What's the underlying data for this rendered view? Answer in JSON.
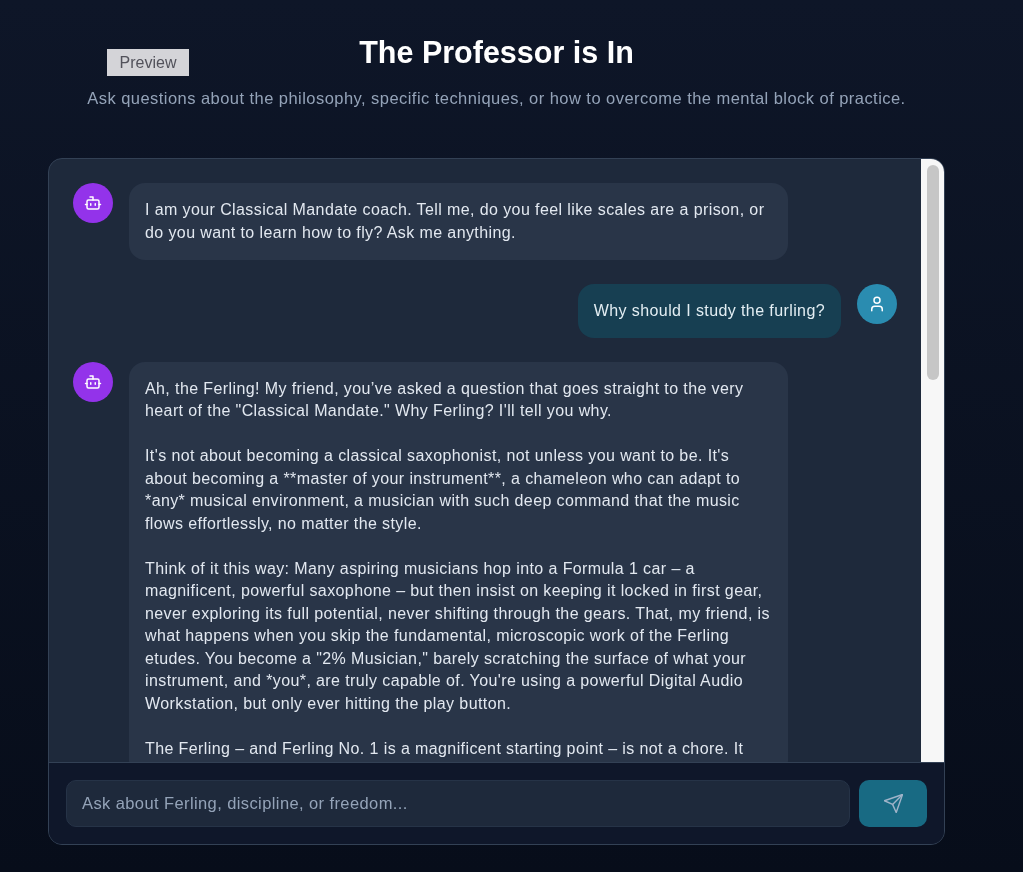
{
  "header": {
    "badge": "Preview",
    "title": "The Professor is In",
    "subtitle": "Ask questions about the philosophy, specific techniques, or how to overcome the mental block of practice."
  },
  "chat": {
    "messages": [
      {
        "kind": "bot",
        "paragraphs": [
          "I am your Classical Mandate coach. Tell me, do you feel like scales are a prison, or do you want to learn how to fly? Ask me anything."
        ]
      },
      {
        "kind": "user",
        "paragraphs": [
          "Why should I study the furling?"
        ]
      },
      {
        "kind": "bot",
        "paragraphs": [
          "Ah, the Ferling! My friend, you’ve asked a question that goes straight to the very heart of the \"Classical Mandate.\" Why Ferling? I'll tell you why.",
          "It's not about becoming a classical saxophonist, not unless you want to be. It's about becoming a **master of your instrument**, a chameleon who can adapt to *any* musical environment, a musician with such deep command that the music flows effortlessly, no matter the style.",
          "Think of it this way: Many aspiring musicians hop into a Formula 1 car – a magnificent, powerful saxophone – but then insist on keeping it locked in first gear, never exploring its full potential, never shifting through the gears. That, my friend, is what happens when you skip the fundamental, microscopic work of the Ferling etudes. You become a \"2% Musician,\" barely scratching the surface of what your instrument, and *you*, are truly capable of. You're using a powerful Digital Audio Workstation, but only ever hitting the play button.",
          "The Ferling – and Ferling No. 1 is a magnificent starting point – is not a chore. It"
        ]
      }
    ]
  },
  "composer": {
    "placeholder": "Ask about Ferling, discipline, or freedom..."
  }
}
